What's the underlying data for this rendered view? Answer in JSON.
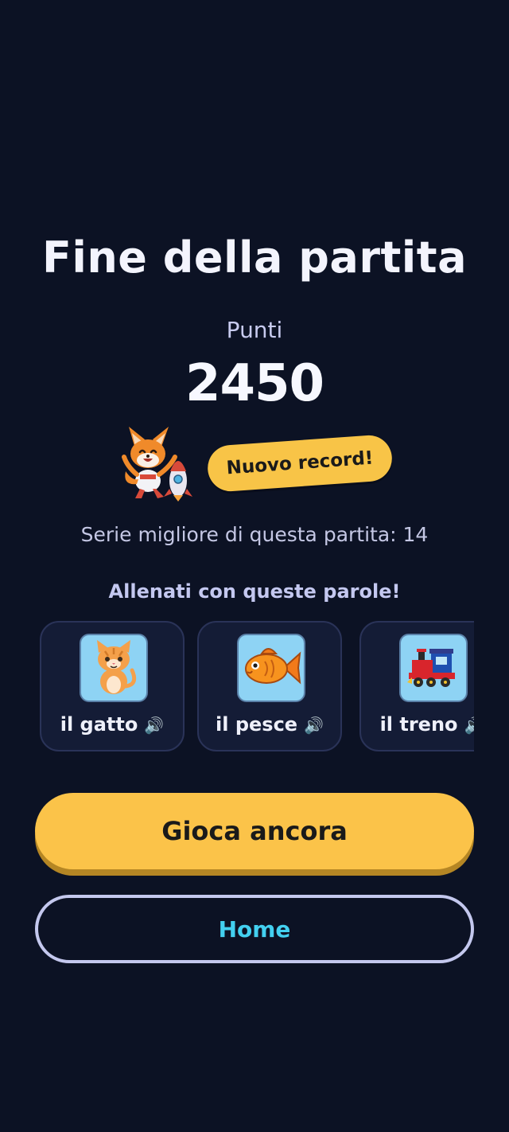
{
  "screen": {
    "title": "Fine della partita",
    "score_label": "Punti",
    "score_value": "2450",
    "badge": "Nuovo record!",
    "streak": "Serie migliore di questa partita: 14",
    "practice_title": "Allenati con queste parole!"
  },
  "words": [
    {
      "label": "il gatto",
      "speaker": "🔊",
      "icon": "cat-icon"
    },
    {
      "label": "il pesce",
      "speaker": "🔊",
      "icon": "fish-icon"
    },
    {
      "label": "il treno",
      "speaker": "🔊",
      "icon": "train-icon"
    }
  ],
  "buttons": {
    "play_again": "Gioca ancora",
    "home": "Home"
  },
  "colors": {
    "background": "#0c1224",
    "accent_yellow": "#fbc349",
    "home_text": "#43d0f0",
    "card_bg": "#141c36"
  }
}
